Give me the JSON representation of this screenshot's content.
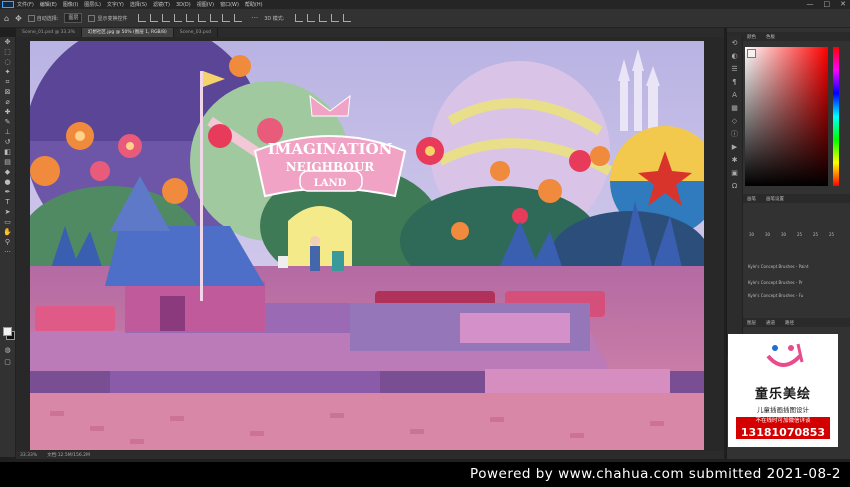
{
  "app": {
    "name": "Photoshop",
    "menu": [
      "文件(F)",
      "编辑(E)",
      "图像(I)",
      "图层(L)",
      "文字(Y)",
      "选择(S)",
      "滤镜(T)",
      "3D(D)",
      "视图(V)",
      "窗口(W)",
      "帮助(H)"
    ],
    "window_controls": [
      "—",
      "□",
      "✕"
    ]
  },
  "options_bar": {
    "auto_select_label": "自动选择:",
    "layer_select_value": "图层",
    "transform_label": "显示变换控件",
    "mode_label": "3D 模式:"
  },
  "document": {
    "tabs": [
      "Scene_01.psd @ 33.3%",
      "幻想社区.jpg @ 50% (图层 1, RGB/8)",
      "Scene_03.psd"
    ],
    "active_tab": 1,
    "zoom": "33.33%",
    "doc_size": "文档:12.5M/156.2M",
    "sign_text": [
      "IMAGINATION",
      "NEIGHBOUR",
      "LAND"
    ]
  },
  "panels": {
    "color_tabs": [
      "颜色",
      "色板"
    ],
    "brush_tabs": [
      "画笔",
      "画笔设置"
    ],
    "layer_tabs": [
      "图层",
      "通道",
      "路径"
    ],
    "brush_sizes": [
      "30",
      "30",
      "30",
      "25",
      "25",
      "25"
    ],
    "brushes": [
      "Kyle's Concept Brushes - Paint",
      "Kyle's Concept Brushes - Pr",
      "Kyle's Concept Brushes - Fu"
    ]
  },
  "ad": {
    "brand": "童乐美绘",
    "subtitle": "儿童插画插图设计",
    "note": "不在线时可加微信详谈",
    "phone": "13181070853"
  },
  "watermark": "Powered by www.chahua.com submitted 2021-08-2",
  "colors": {
    "foreground": "#f2f2f2",
    "background": "#111111",
    "sky": "#c9c4ea",
    "ground": "#c7719f",
    "sign": "#f0a3c4",
    "accent": "#e94b8f"
  }
}
